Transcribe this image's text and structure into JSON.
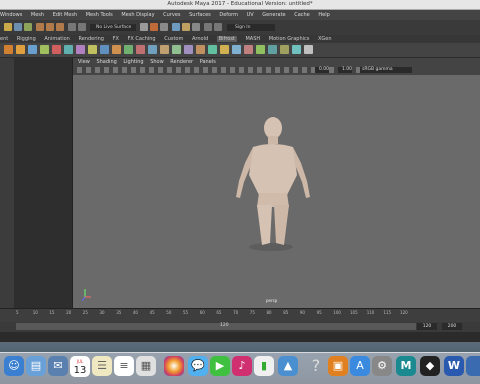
{
  "window": {
    "title": "Autodesk Maya 2017 - Educational Version: untitled*"
  },
  "menubar": {
    "items": [
      "Windows",
      "Mesh",
      "Edit Mesh",
      "Mesh Tools",
      "Mesh Display",
      "Curves",
      "Surfaces",
      "Deform",
      "UV",
      "Generate",
      "Cache",
      "Help"
    ]
  },
  "status": {
    "live_surface": "No Live Surface",
    "sign_in": "Sign In"
  },
  "shelf_tabs": [
    "ent",
    "Rigging",
    "Animation",
    "Rendering",
    "FX",
    "FX Caching",
    "Custom",
    "Arnold",
    "Bifrost",
    "MASH",
    "Motion Graphics",
    "XGen"
  ],
  "shelf_active": "Bifrost",
  "viewport_menu": [
    "View",
    "Shading",
    "Lighting",
    "Show",
    "Renderer",
    "Panels"
  ],
  "viewport_fields": {
    "exposure": "0.00",
    "gamma_value": "1.00",
    "color_space": "sRGB gamma"
  },
  "camera_label": "persp",
  "timeline": {
    "ticks": [
      "5",
      "10",
      "15",
      "20",
      "25",
      "30",
      "35",
      "40",
      "45",
      "50",
      "55",
      "60",
      "65",
      "70",
      "75",
      "80",
      "85",
      "90",
      "95",
      "100",
      "105",
      "110",
      "115",
      "120"
    ],
    "range_value": "120",
    "start": "120",
    "end": "200"
  },
  "dock": {
    "calendar_month": "JUL",
    "calendar_day": "13"
  },
  "colors": {
    "viewport_bg": "#6a6a6a",
    "panel": "#444444",
    "figure": "#d6c2b3"
  }
}
